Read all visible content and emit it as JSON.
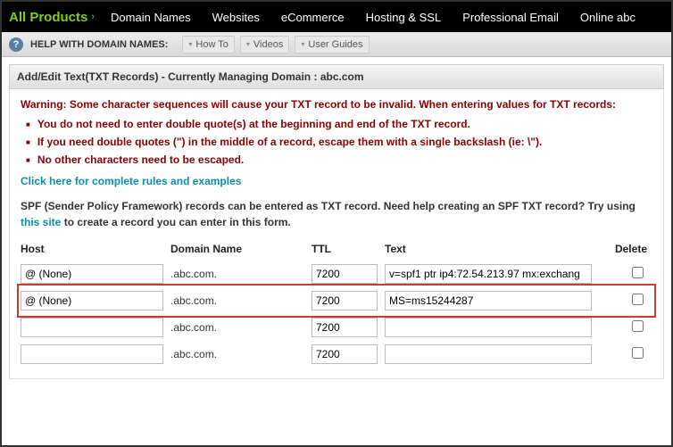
{
  "nav": {
    "brand": "All Products",
    "items": [
      "Domain Names",
      "Websites",
      "eCommerce",
      "Hosting & SSL",
      "Professional Email",
      "Online abc"
    ]
  },
  "helpbar": {
    "label": "HELP WITH DOMAIN NAMES:",
    "items": [
      "How To",
      "Videos",
      "User Guides"
    ]
  },
  "panel": {
    "title_prefix": "Add/Edit Text(TXT Records) - Currently Managing Domain :",
    "domain": "abc.com"
  },
  "warning": {
    "heading": "Warning: Some character sequences will cause your TXT record to be invalid. When entering values for TXT records:",
    "bullets": [
      "You do not need to enter double quote(s) at the beginning and end of the TXT record.",
      "If you need double quotes (\") in the middle of a record, escape them with a single backslash (ie: \\\").",
      "No other characters need to be escaped."
    ],
    "rules_link": "Click here for complete rules and examples"
  },
  "spf": {
    "text_before": "SPF (Sender Policy Framework) records can be entered as TXT record. Need help creating an SPF TXT record? Try using ",
    "link": "this site",
    "text_after": " to create a record you can enter in this form."
  },
  "table": {
    "headers": {
      "host": "Host",
      "domain": "Domain Name",
      "ttl": "TTL",
      "text": "Text",
      "del": "Delete"
    },
    "rows": [
      {
        "host": "@ (None)",
        "domain": ".abc.com.",
        "ttl": "7200",
        "text": "v=spf1 ptr ip4:72.54.213.97 mx:exchang",
        "highlight": false
      },
      {
        "host": "@ (None)",
        "domain": ".abc.com.",
        "ttl": "7200",
        "text": "MS=ms15244287",
        "highlight": true
      },
      {
        "host": "",
        "domain": ".abc.com.",
        "ttl": "7200",
        "text": "",
        "highlight": false
      },
      {
        "host": "",
        "domain": ".abc.com.",
        "ttl": "7200",
        "text": "",
        "highlight": false
      }
    ]
  }
}
